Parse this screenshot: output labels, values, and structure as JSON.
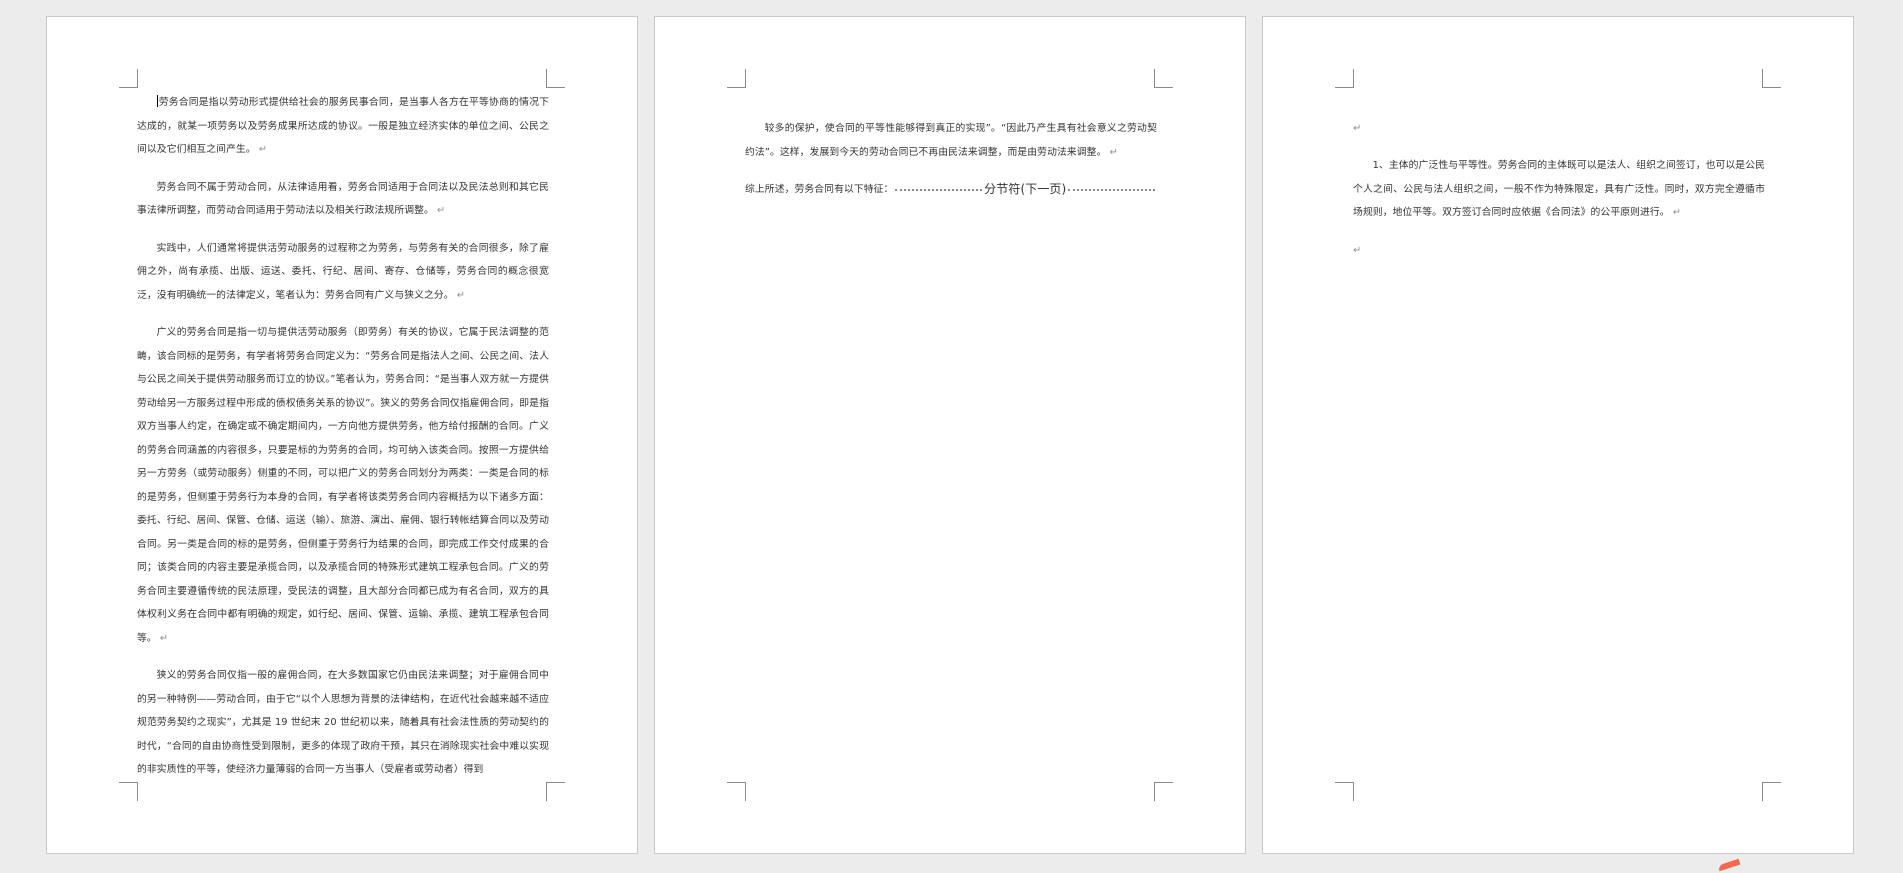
{
  "pages": [
    {
      "paragraphs": [
        "劳务合同是指以劳动形式提供给社会的服务民事合同，是当事人各方在平等协商的情况下达成的，就某一项劳务以及劳务成果所达成的协议。一般是独立经济实体的单位之间、公民之间以及它们相互之间产生。",
        "劳务合同不属于劳动合同，从法律适用看，劳务合同适用于合同法以及民法总则和其它民事法律所调整，而劳动合同适用于劳动法以及相关行政法规所调整。",
        "实践中，人们通常将提供活劳动服务的过程称之为劳务，与劳务有关的合同很多，除了雇佣之外，尚有承揽、出版、运送、委托、行纪、居间、寄存、仓储等，劳务合同的概念很宽泛，没有明确统一的法律定义，笔者认为：劳务合同有广义与狭义之分。",
        "广义的劳务合同是指一切与提供活劳动服务（即劳务）有关的协议，它属于民法调整的范畴，该合同标的是劳务，有学者将劳务合同定义为：“劳务合同是指法人之间、公民之间、法人与公民之间关于提供劳动服务而订立的协议。”笔者认为，劳务合同：“是当事人双方就一方提供劳动给另一方服务过程中形成的债权债务关系的协议”。狭义的劳务合同仅指雇佣合同，即是指双方当事人约定，在确定或不确定期间内，一方向他方提供劳务，他方给付报酬的合同。广义的劳务合同涵盖的内容很多，只要是标的为劳务的合同，均可纳入该类合同。按照一方提供给另一方劳务（或劳动服务）侧重的不同，可以把广义的劳务合同划分为两类：一类是合同的标的是劳务，但侧重于劳务行为本身的合同，有学者将该类劳务合同内容概括为以下诸多方面：委托、行纪、居间、保管、仓储、运送（输）、旅游、演出、雇佣、银行转帐结算合同以及劳动合同。另一类是合同的标的是劳务，但侧重于劳务行为结果的合同，即完成工作交付成果的合同；该类合同的内容主要是承揽合同，以及承揽合同的特殊形式建筑工程承包合同。广义的劳务合同主要遵循传统的民法原理，受民法的调整，且大部分合同都已成为有名合同，双方的具体权利义务在合同中都有明确的规定，如行纪、居间、保管、运输、承揽、建筑工程承包合同等。",
        "狭义的劳务合同仅指一般的雇佣合同，在大多数国家它仍由民法来调整；对于雇佣合同中的另一种特例——劳动合同，由于它“以个人思想为背景的法律结构，在近代社会越来越不适应规范劳务契约之现实”，尤其是 19 世纪末 20 世纪初以来，随着具有社会法性质的劳动契约的时代，“合同的自由协商性受到限制，更多的体现了政府干预，其只在消除现实社会中难以实现的非实质性的平等，使经济力量薄弱的合同一方当事人（受雇者或劳动者）得到"
      ]
    },
    {
      "paragraphs": [
        "较多的保护，使合同的平等性能够得到真正的实现”。“因此乃产生具有社会意义之劳动契约法”。这样，发展到今天的劳动合同已不再由民法来调整，而是由劳动法来调整。"
      ],
      "closing_text": "综上所述，劳务合同有以下特征：",
      "section_break_label": "分节符(下一页)"
    },
    {
      "paragraphs": [
        "1、主体的广泛性与平等性。劳务合同的主体既可以是法人、组织之间签订，也可以是公民个人之间、公民与法人组织之间，一般不作为特殊限定，具有广泛性。同时，双方完全遵循市场规则，地位平等。双方签订合同时应依据《合同法》的公平原则进行。"
      ]
    }
  ],
  "paragraph_mark": "↵",
  "empty_paragraph_mark": "↵"
}
